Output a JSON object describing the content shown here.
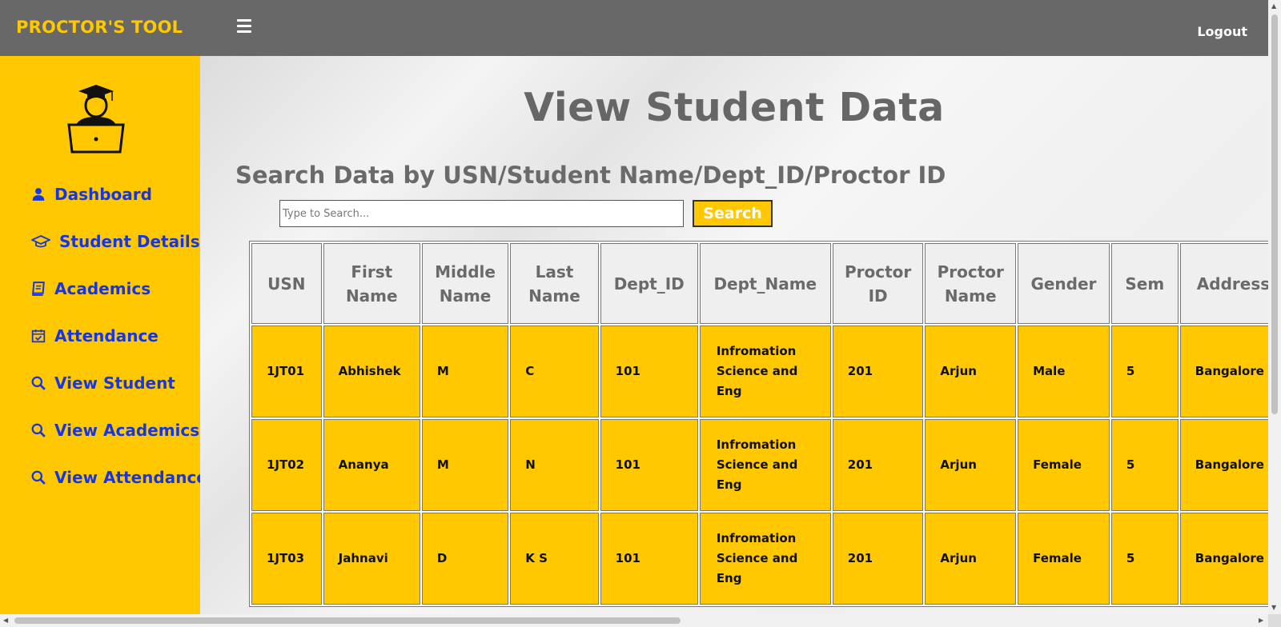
{
  "header": {
    "brand": "PROCTOR'S TOOL",
    "logout_label": "Logout"
  },
  "sidebar": {
    "items": [
      {
        "label": "Dashboard",
        "icon": "user-icon"
      },
      {
        "label": "Student Details",
        "icon": "graduation-cap-icon"
      },
      {
        "label": "Academics",
        "icon": "book-icon"
      },
      {
        "label": "Attendance",
        "icon": "calendar-check-icon"
      },
      {
        "label": "View Student",
        "icon": "search-icon"
      },
      {
        "label": "View Academics",
        "icon": "search-icon"
      },
      {
        "label": "View Attendance",
        "icon": "search-icon"
      }
    ]
  },
  "main": {
    "title": "View Student Data",
    "search_label": "Search Data by USN/Student Name/Dept_ID/Proctor ID",
    "search_placeholder": "Type to Search...",
    "search_button": "Search"
  },
  "table": {
    "columns": [
      "USN",
      "First Name",
      "Middle Name",
      "Last Name",
      "Dept_ID",
      "Dept_Name",
      "Proctor ID",
      "Proctor Name",
      "Gender",
      "Sem",
      "Address"
    ],
    "rows": [
      [
        "1JT01",
        "Abhishek",
        "M",
        "C",
        "101",
        "Infromation Science and Eng",
        "201",
        "Arjun",
        "Male",
        "5",
        "Bangalore"
      ],
      [
        "1JT02",
        "Ananya",
        "M",
        "N",
        "101",
        "Infromation Science and Eng",
        "201",
        "Arjun",
        "Female",
        "5",
        "Bangalore"
      ],
      [
        "1JT03",
        "Jahnavi",
        "D",
        "K S",
        "101",
        "Infromation Science and Eng",
        "201",
        "Arjun",
        "Female",
        "5",
        "Bangalore"
      ]
    ]
  },
  "colors": {
    "accent": "#ffc800",
    "nav_text": "#1736e0",
    "topbar": "#686868"
  }
}
